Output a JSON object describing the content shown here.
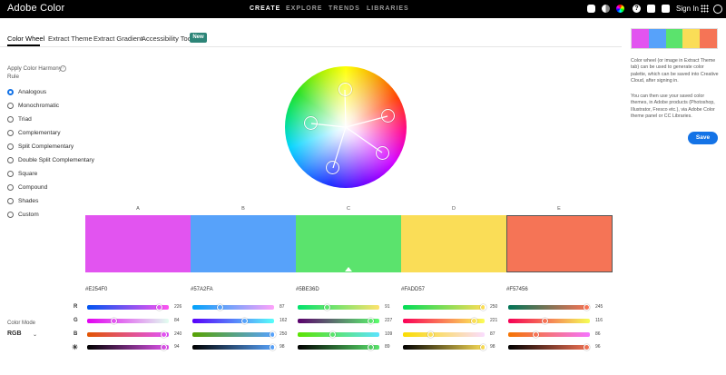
{
  "app": {
    "title": "Adobe Color",
    "sign_in": "Sign In"
  },
  "nav": [
    "CREATE",
    "EXPLORE",
    "TRENDS",
    "LIBRARIES"
  ],
  "tabs": [
    "Color Wheel",
    "Extract Theme",
    "Extract Gradient",
    "Accessibility Tools"
  ],
  "new_badge": "New",
  "harmony": {
    "title": "Apply Color Harmony Rule",
    "info": "?",
    "options": [
      "Analogous",
      "Monochromatic",
      "Triad",
      "Complementary",
      "Split Complementary",
      "Double Split Complementary",
      "Square",
      "Compound",
      "Shades",
      "Custom"
    ],
    "selected": "Analogous"
  },
  "color_mode": {
    "title": "Color Mode",
    "value": "RGB"
  },
  "channels": [
    "R",
    "G",
    "B",
    "☀"
  ],
  "swatches": [
    {
      "label": "A",
      "hex": "#E254F0",
      "color": "#e254f0",
      "values": [
        226,
        84,
        240,
        94
      ]
    },
    {
      "label": "B",
      "hex": "#57A2FA",
      "color": "#57a2fa",
      "values": [
        87,
        162,
        250,
        98
      ]
    },
    {
      "label": "C",
      "hex": "#5BE36D",
      "color": "#5be36d",
      "values": [
        91,
        227,
        109,
        89
      ],
      "base": true
    },
    {
      "label": "D",
      "hex": "#FADD57",
      "color": "#fadd57",
      "values": [
        250,
        221,
        87,
        98
      ]
    },
    {
      "label": "E",
      "hex": "#F57456",
      "color": "#f57456",
      "values": [
        245,
        116,
        86,
        96
      ]
    }
  ],
  "right_panel": {
    "text1": "Color wheel (or image in Extract Theme tab) can be used to generate color palette, which can be saved into Creative Cloud, after signing in.",
    "text2": "You can then use your saved color themes, in Adobe products (Photoshop, Illustrator, Fresco etc.), via Adobe Color theme panel or CC Libraries.",
    "save": "Save"
  }
}
